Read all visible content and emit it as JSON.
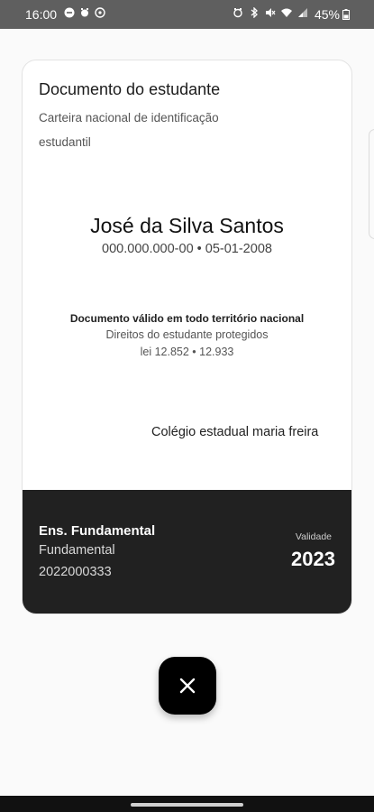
{
  "status_bar": {
    "time": "16:00",
    "battery": "45%",
    "left_icons": [
      "minus-circle-icon",
      "alarm-icon",
      "location-icon"
    ],
    "right_icons": [
      "alarm-icon",
      "bluetooth-icon",
      "mute-icon",
      "wifi-icon",
      "signal-icon"
    ]
  },
  "card": {
    "title": "Documento do estudante",
    "subtitle": "Carteira nacional de identificação estudantil",
    "student_name": "José da Silva Santos",
    "student_id_line": "000.000.000-00 • 05-01-2008",
    "validity_title": "Documento válido em todo território nacional",
    "rights_line": "Direitos do estudante protegidos",
    "law_line": "lei 12.852 • 12.933",
    "school_name": "Colégio estadual maria freira",
    "footer": {
      "level_title": "Ens. Fundamental",
      "level_sub": "Fundamental",
      "enrollment": "2022000333",
      "validity_label": "Validade",
      "validity_year": "2023"
    }
  },
  "close_button": {
    "icon": "close-icon"
  }
}
